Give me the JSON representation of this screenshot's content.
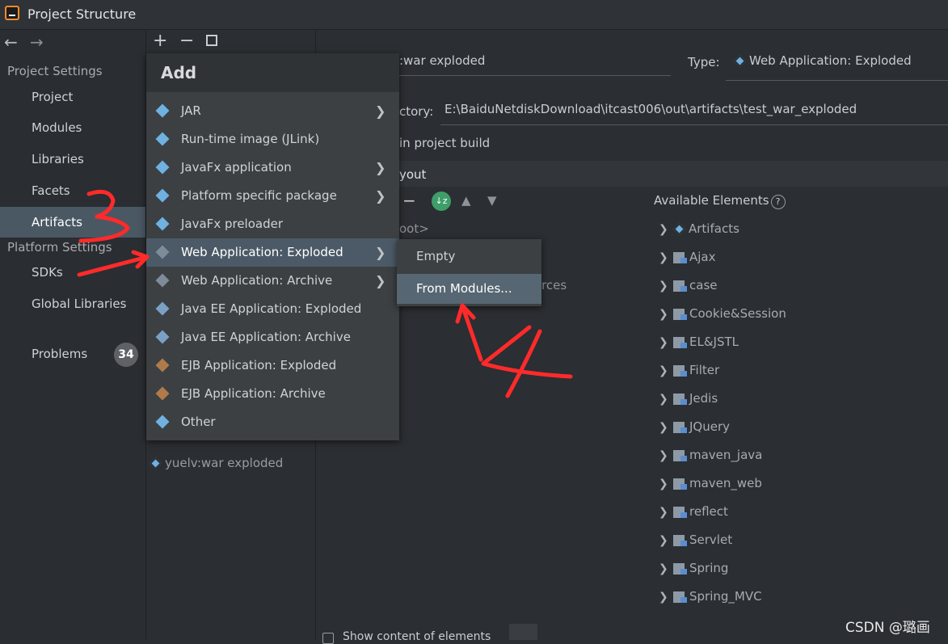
{
  "window": {
    "title": "Project Structure"
  },
  "sidebar": {
    "project_settings_label": "Project Settings",
    "platform_settings_label": "Platform Settings",
    "items": [
      "Project",
      "Modules",
      "Libraries",
      "Facets",
      "Artifacts"
    ],
    "platform_items": [
      "SDKs",
      "Global Libraries"
    ],
    "problems_label": "Problems",
    "problems_count": "34"
  },
  "artifact_list": {
    "visible_item": "yuelv:war exploded"
  },
  "details": {
    "name_value": ":war exploded",
    "type_label": "Type:",
    "type_value": "Web Application: Exploded",
    "output_dir_label": "ctory:",
    "output_dir_value": "E:\\BaiduNetdiskDownload\\itcast006\\out\\artifacts\\test_war_exploded",
    "include_build_text": "in project build",
    "layout_tab": "yout",
    "tree_root": "oot>",
    "tree_partial": "rces",
    "available_label": "Available Elements",
    "available_items": [
      "Artifacts",
      "Ajax",
      "case",
      "Cookie&Session",
      "EL&JSTL",
      "Filter",
      "Jedis",
      "JQuery",
      "maven_java",
      "maven_web",
      "reflect",
      "Servlet",
      "Spring",
      "Spring_MVC"
    ],
    "show_content_label": "Show content of elements"
  },
  "add_menu": {
    "title": "Add",
    "items": [
      {
        "label": "JAR",
        "submenu": true
      },
      {
        "label": "Run-time image (JLink)",
        "submenu": false
      },
      {
        "label": "JavaFx application",
        "submenu": true
      },
      {
        "label": "Platform specific package",
        "submenu": true
      },
      {
        "label": "JavaFx preloader",
        "submenu": false
      },
      {
        "label": "Web Application: Exploded",
        "submenu": true
      },
      {
        "label": "Web Application: Archive",
        "submenu": true
      },
      {
        "label": "Java EE Application: Exploded",
        "submenu": false
      },
      {
        "label": "Java EE Application: Archive",
        "submenu": false
      },
      {
        "label": "EJB Application: Exploded",
        "submenu": false
      },
      {
        "label": "EJB Application: Archive",
        "submenu": false
      },
      {
        "label": "Other",
        "submenu": false
      }
    ],
    "highlighted_index": 5
  },
  "submenu": {
    "items": [
      "Empty",
      "From Modules..."
    ],
    "highlighted_index": 1
  },
  "annotations": {
    "step3": "3",
    "step4": "4",
    "color": "#ff2a2a"
  },
  "watermark": "CSDN @璐画",
  "colors": {
    "selection": "#4a5864",
    "accent_blue": "#6fb1e0",
    "badge": "#5e6266"
  }
}
